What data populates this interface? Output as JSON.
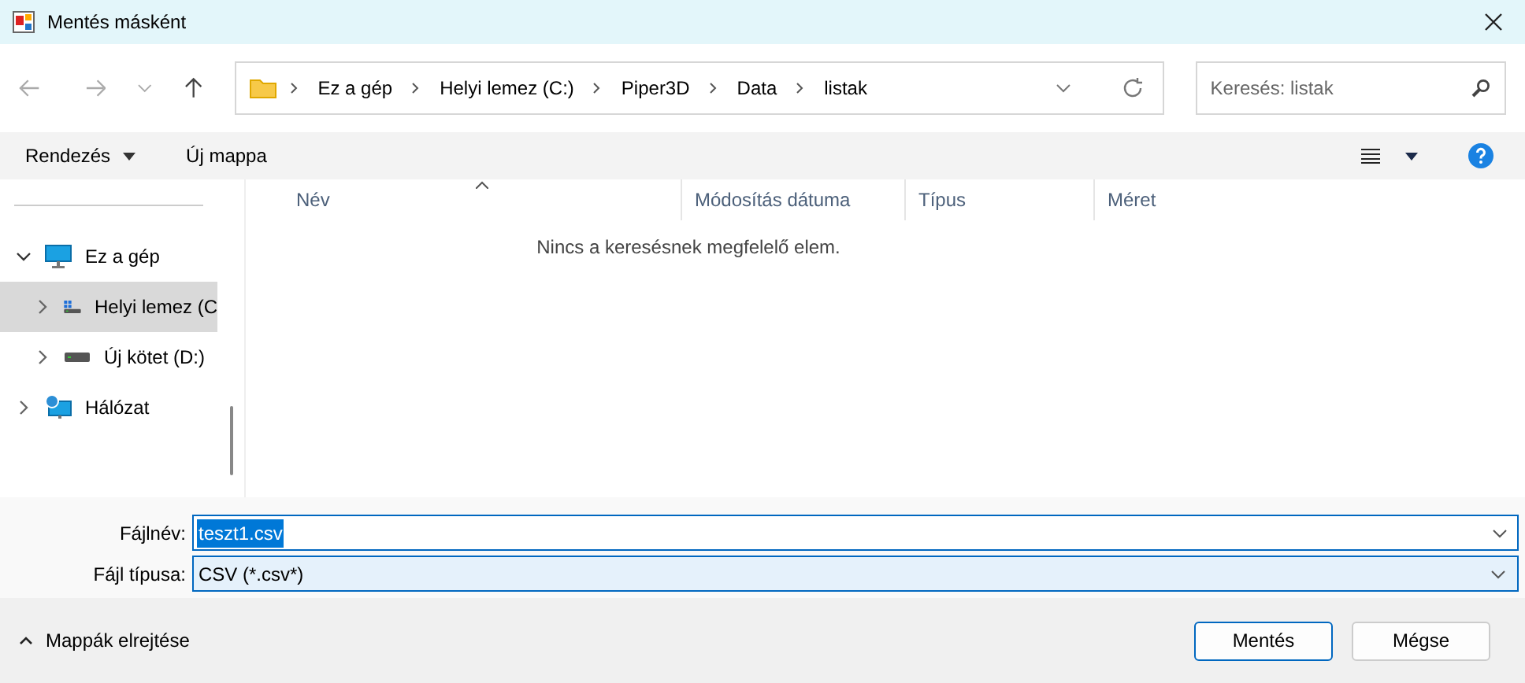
{
  "window": {
    "title": "Mentés másként"
  },
  "breadcrumb": [
    "Ez a gép",
    "Helyi lemez (C:)",
    "Piper3D",
    "Data",
    "listak"
  ],
  "search": {
    "placeholder": "Keresés: listak"
  },
  "toolbar": {
    "organize": "Rendezés",
    "new_folder": "Új mappa"
  },
  "sidebar": {
    "items": [
      {
        "label": "Ez a gép",
        "kind": "computer",
        "expanded": true,
        "selected": false,
        "children": [
          {
            "label": "Helyi lemez (C",
            "kind": "system-drive",
            "expanded": false,
            "selected": true
          },
          {
            "label": "Új kötet (D:)",
            "kind": "drive",
            "expanded": false,
            "selected": false
          }
        ]
      },
      {
        "label": "Hálózat",
        "kind": "network",
        "expanded": false,
        "selected": false
      }
    ]
  },
  "table": {
    "columns": [
      "Név",
      "Módosítás dátuma",
      "Típus",
      "Méret"
    ],
    "empty_message": "Nincs a keresésnek megfelelő elem."
  },
  "form": {
    "filename_label": "Fájlnév:",
    "filename": "teszt1.csv",
    "filetype_label": "Fájl típusa:",
    "filetype": "CSV (*.csv*)"
  },
  "footer": {
    "hide_folders": "Mappák elrejtése",
    "buttons": [
      "Mentés",
      "Mégse"
    ]
  }
}
